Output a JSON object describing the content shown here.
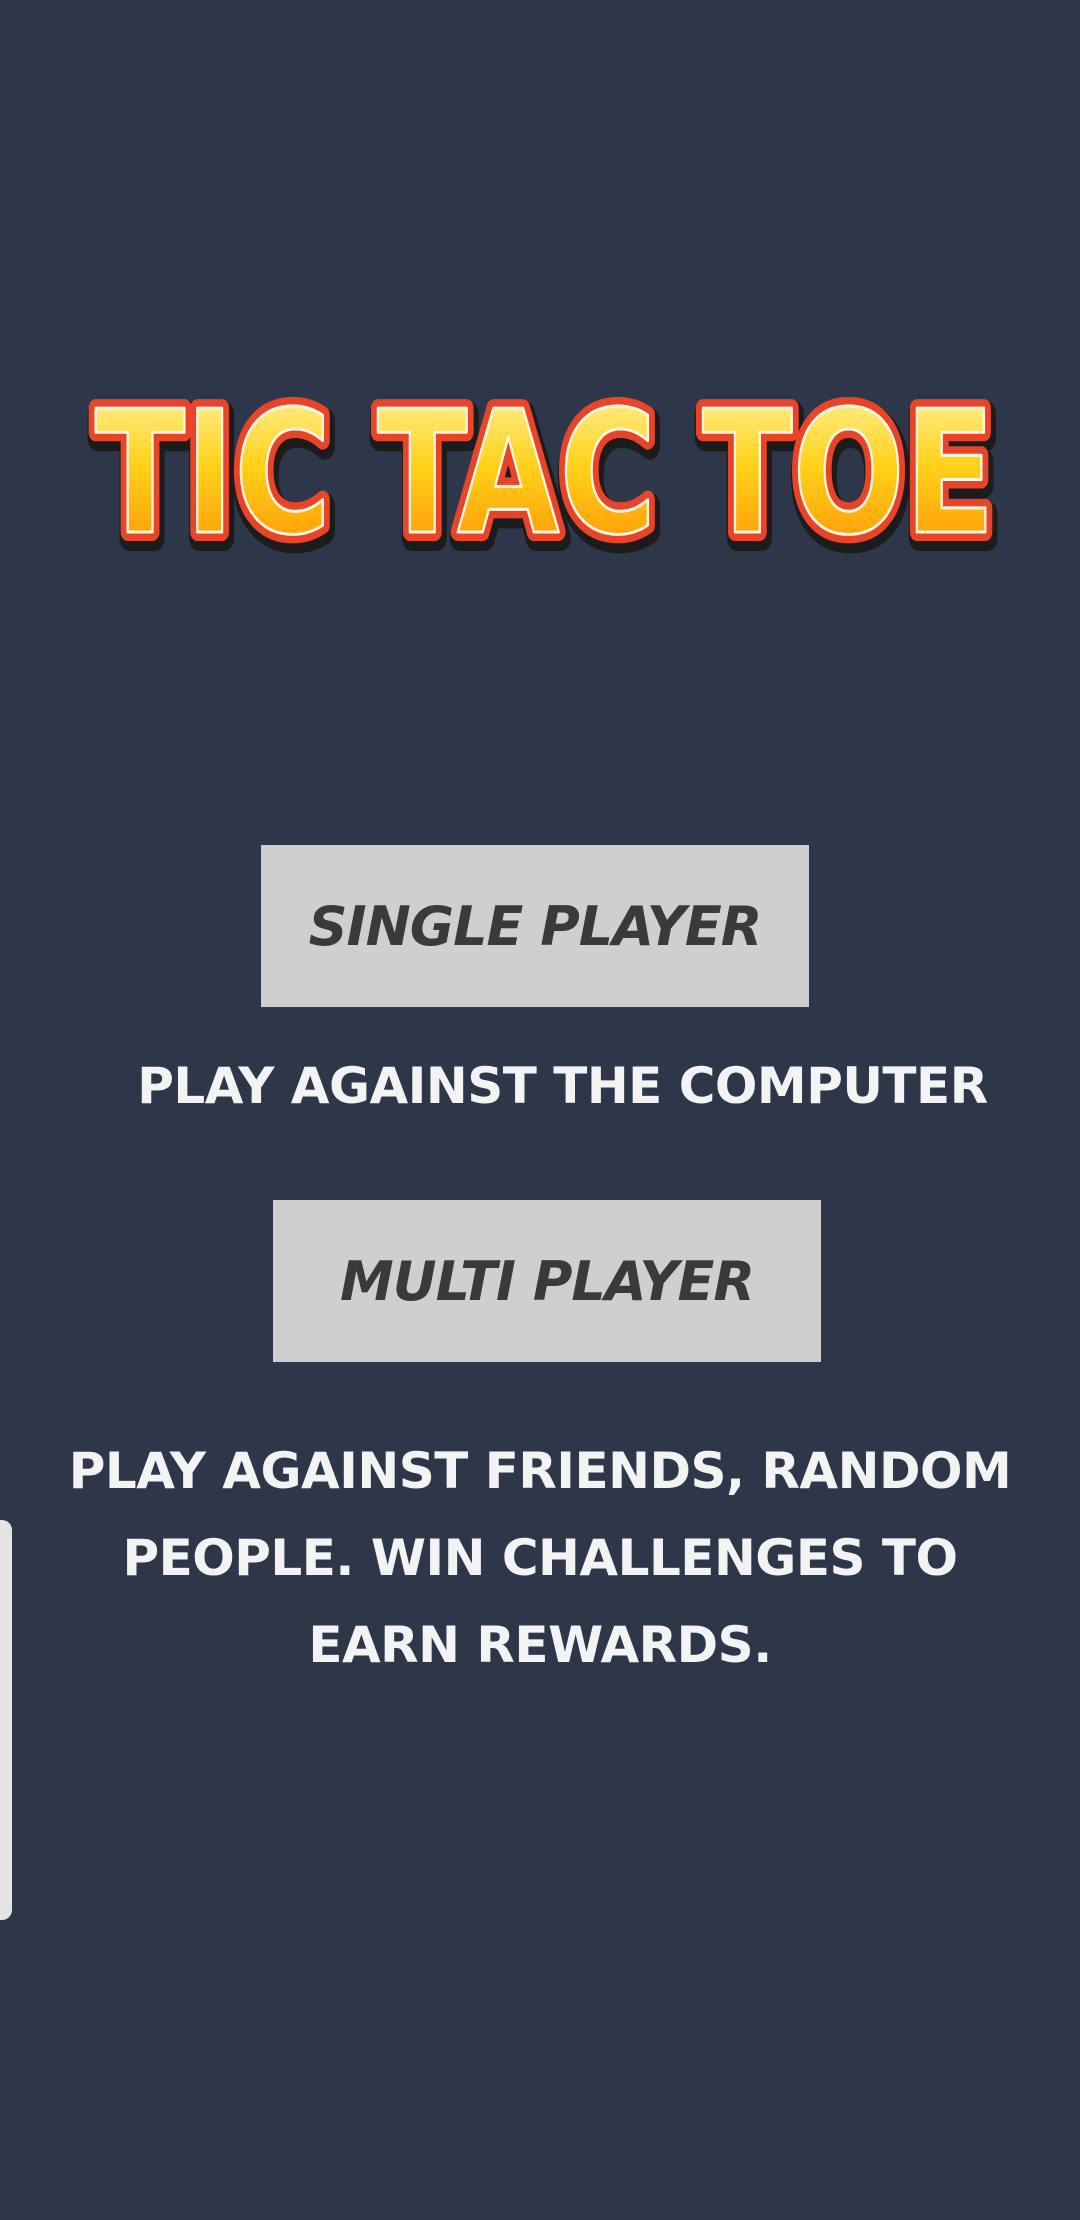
{
  "logo": {
    "text": "TIC TAC TOE",
    "colors": {
      "fill_top": "#fff7b0",
      "fill_mid": "#ffd21a",
      "fill_bottom": "#ff8a00",
      "outline": "#e8442a",
      "shadow": "#1c1c1c"
    }
  },
  "single_player": {
    "label": "SINGLE PLAYER",
    "description": "PLAY AGAINST THE COMPUTER"
  },
  "multi_player": {
    "label": "MULTI PLAYER",
    "description": "PLAY AGAINST FRIENDS, RANDOM PEOPLE. WIN CHALLENGES TO EARN REWARDS."
  },
  "theme": {
    "background": "#2e3749",
    "button_bg": "#cfcfcf",
    "button_text": "#3a3a3a",
    "description_text": "#f3f3f3"
  }
}
